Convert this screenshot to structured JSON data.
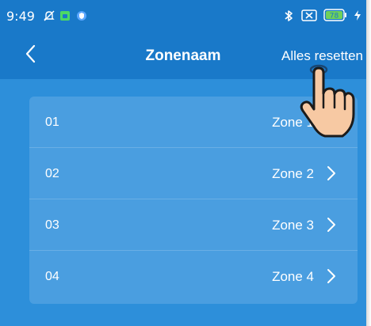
{
  "status_bar": {
    "time": "9:49",
    "battery_level": "78",
    "icons": [
      "notifications-off-icon",
      "app-badge-icon",
      "shield-icon",
      "bluetooth-icon",
      "no-sim-icon",
      "battery-icon",
      "charging-icon"
    ]
  },
  "header": {
    "title": "Zonenaam",
    "reset_label": "Alles resetten",
    "back_icon": "chevron-left-icon"
  },
  "zones": [
    {
      "number": "01",
      "name": "Zone 1"
    },
    {
      "number": "02",
      "name": "Zone 2"
    },
    {
      "number": "03",
      "name": "Zone 3"
    },
    {
      "number": "04",
      "name": "Zone 4"
    }
  ],
  "colors": {
    "header_bg": "#1979c9",
    "page_bg": "#2d8fda",
    "card_bg": "#4a9ee0",
    "text": "#ffffff",
    "battery_green": "#6fd15a",
    "app_badge_green": "#4cd964"
  }
}
